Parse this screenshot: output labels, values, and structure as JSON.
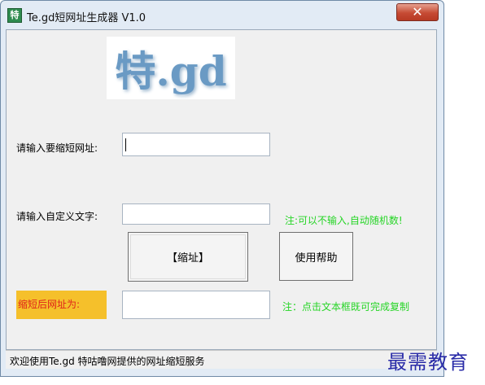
{
  "window": {
    "icon_text": "特",
    "title": "Te.gd短网址生成器 V1.0",
    "close_glyph": "✕"
  },
  "logo": {
    "text": "特.gd"
  },
  "form": {
    "url_label": "请输入要缩短网址:",
    "url_value": "",
    "custom_label": "请输入自定义文字:",
    "custom_value": "",
    "custom_note": "注:可以不输入,自动随机数!",
    "shorten_button": "【缩址】",
    "help_button": "使用帮助",
    "result_label": "缩短后网址为:",
    "result_value": "",
    "result_note": "注：点击文本框既可完成复制"
  },
  "statusbar": {
    "text": "欢迎使用Te.gd 特咕噜网提供的网址缩短服务"
  },
  "watermark": {
    "text": "最需教育"
  },
  "colors": {
    "note_green": "#26d526",
    "result_label_bg": "#f5c02b",
    "result_label_fg": "#e0241a"
  }
}
